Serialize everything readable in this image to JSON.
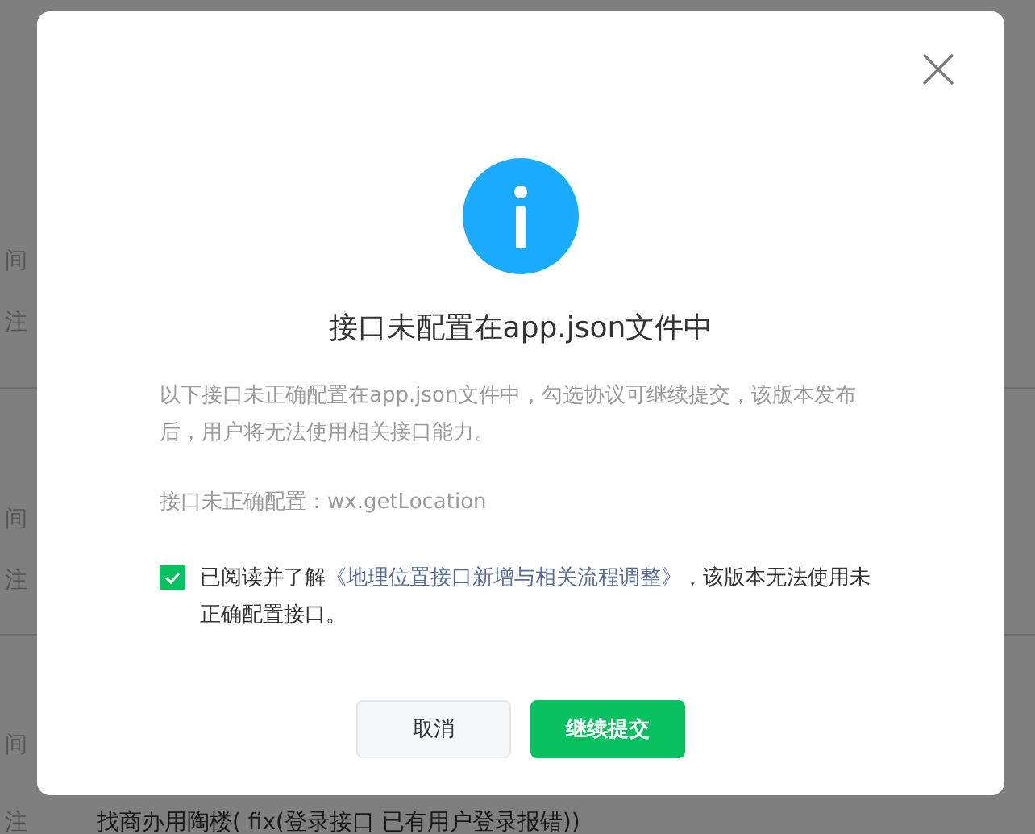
{
  "background": {
    "groups": [
      {
        "labels": [
          "间",
          "注"
        ]
      },
      {
        "labels": [
          "间",
          "注"
        ]
      },
      {
        "labels": [
          "间"
        ],
        "value_label": "注",
        "value": "找商办用陶楼( fix(登录接口 已有用户登录报错))"
      }
    ]
  },
  "dialog": {
    "title": "接口未配置在app.json文件中",
    "description": "以下接口未正确配置在app.json文件中，勾选协议可继续提交，该版本发布后，用户将无法使用相关接口能力。",
    "config_line": "接口未正确配置：wx.getLocation",
    "agreement": {
      "checked": true,
      "before": "已阅读并了解",
      "link": "《地理位置接口新增与相关流程调整》",
      "after": "，该版本无法使用未正确配置接口。"
    },
    "buttons": [
      {
        "label": "取消",
        "kind": "secondary"
      },
      {
        "label": "继续提交",
        "kind": "primary"
      }
    ]
  }
}
